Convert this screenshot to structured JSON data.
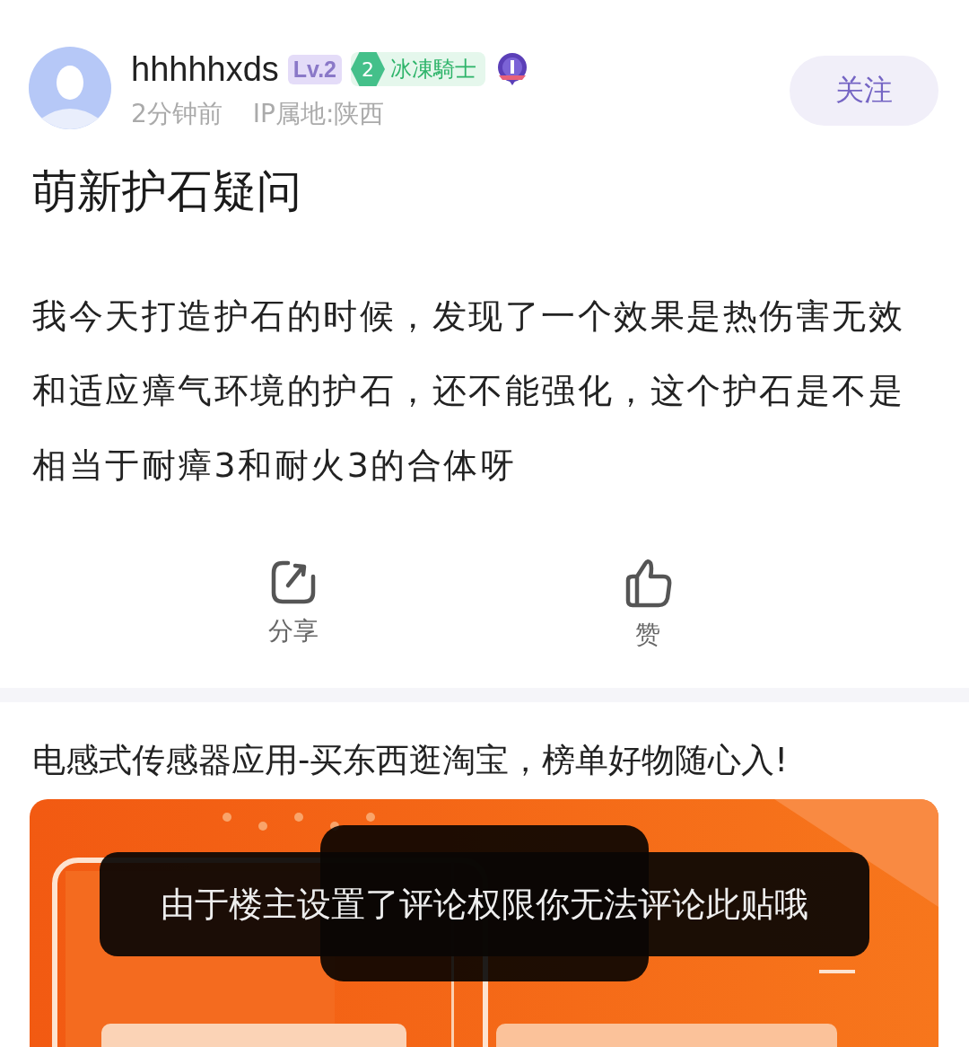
{
  "author": {
    "name": "hhhhhxds",
    "level": "Lv.2",
    "badge_number": "2",
    "badge_title": "冰凍騎士"
  },
  "post_time": "2分钟前",
  "ip_location": "IP属地:陕西",
  "follow_button": "关注",
  "title": "萌新护石疑问",
  "body": "我今天打造护石的时候，发现了一个效果是热伤害无效和适应瘴气环境的护石，还不能强化，这个护石是不是相当于耐瘴3和耐火3的合体呀",
  "actions": [
    {
      "kind": "share",
      "label": "分享"
    },
    {
      "kind": "like",
      "label": "赞"
    }
  ],
  "ad": {
    "title": "电感式传感器应用-买东西逛淘宝，榜单好物随心入!",
    "kind": "picture"
  },
  "toast": {
    "message": "由于楼主设置了评论权限你无法评论此贴哦"
  }
}
